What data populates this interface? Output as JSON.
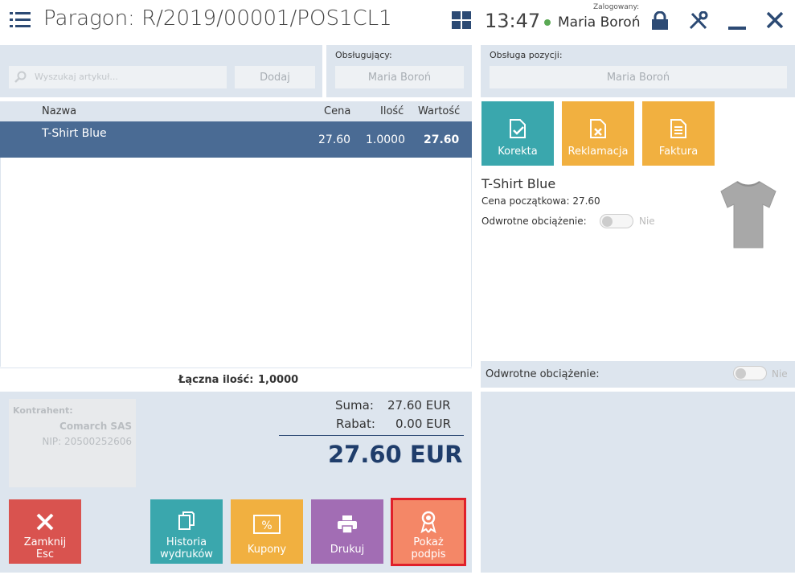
{
  "header": {
    "title": "Paragon: R/2019/00001/POS1CL1",
    "time": "13:47",
    "logged_label": "Zalogowany:",
    "user": "Maria Boroń"
  },
  "search": {
    "placeholder": "Wyszukaj artykuł...",
    "add_label": "Dodaj"
  },
  "serving": {
    "label": "Obsługujący:",
    "value": "Maria Boroń"
  },
  "table": {
    "columns": [
      "Nazwa",
      "Cena",
      "Ilość",
      "Wartość"
    ],
    "rows": [
      {
        "name": "T-Shirt Blue",
        "price": "27.60",
        "qty": "1.0000",
        "value": "27.60"
      }
    ]
  },
  "summary": {
    "total_qty_label": "Łączna ilość:",
    "total_qty_value": "1,0000"
  },
  "customer": {
    "label": "Kontrahent:",
    "name": "Comarch SAS",
    "nip": "NIP: 20500252606"
  },
  "totals": {
    "sum_label": "Suma:",
    "sum_value": "27.60 EUR",
    "discount_label": "Rabat:",
    "discount_value": "0.00 EUR",
    "grand_total": "27.60 EUR"
  },
  "bottom_buttons": {
    "close_line1": "Zamknij",
    "close_line2": "Esc",
    "history_line1": "Historia",
    "history_line2": "wydruków",
    "coupons": "Kupony",
    "print": "Drukuj",
    "signature_line1": "Pokaż",
    "signature_line2": "podpis"
  },
  "position": {
    "label": "Obsługa pozycji:",
    "value": "Maria Boroń"
  },
  "action_tiles": {
    "correction": "Korekta",
    "complaint": "Reklamacja",
    "invoice": "Faktura"
  },
  "item_detail": {
    "name": "T-Shirt Blue",
    "initial_price": "Cena początkowa: 27.60",
    "reverse_label": "Odwrotne obciążenie:",
    "reverse_value": "Nie"
  },
  "reverse_charge": {
    "label": "Odwrotne obciążenie:",
    "value": "Nie"
  },
  "colors": {
    "teal": "#3aa7ad",
    "orange": "#f1b040",
    "red": "#d9534f",
    "purple": "#a26db4",
    "salmon": "#f48767",
    "header_blue": "#2c4a74"
  }
}
